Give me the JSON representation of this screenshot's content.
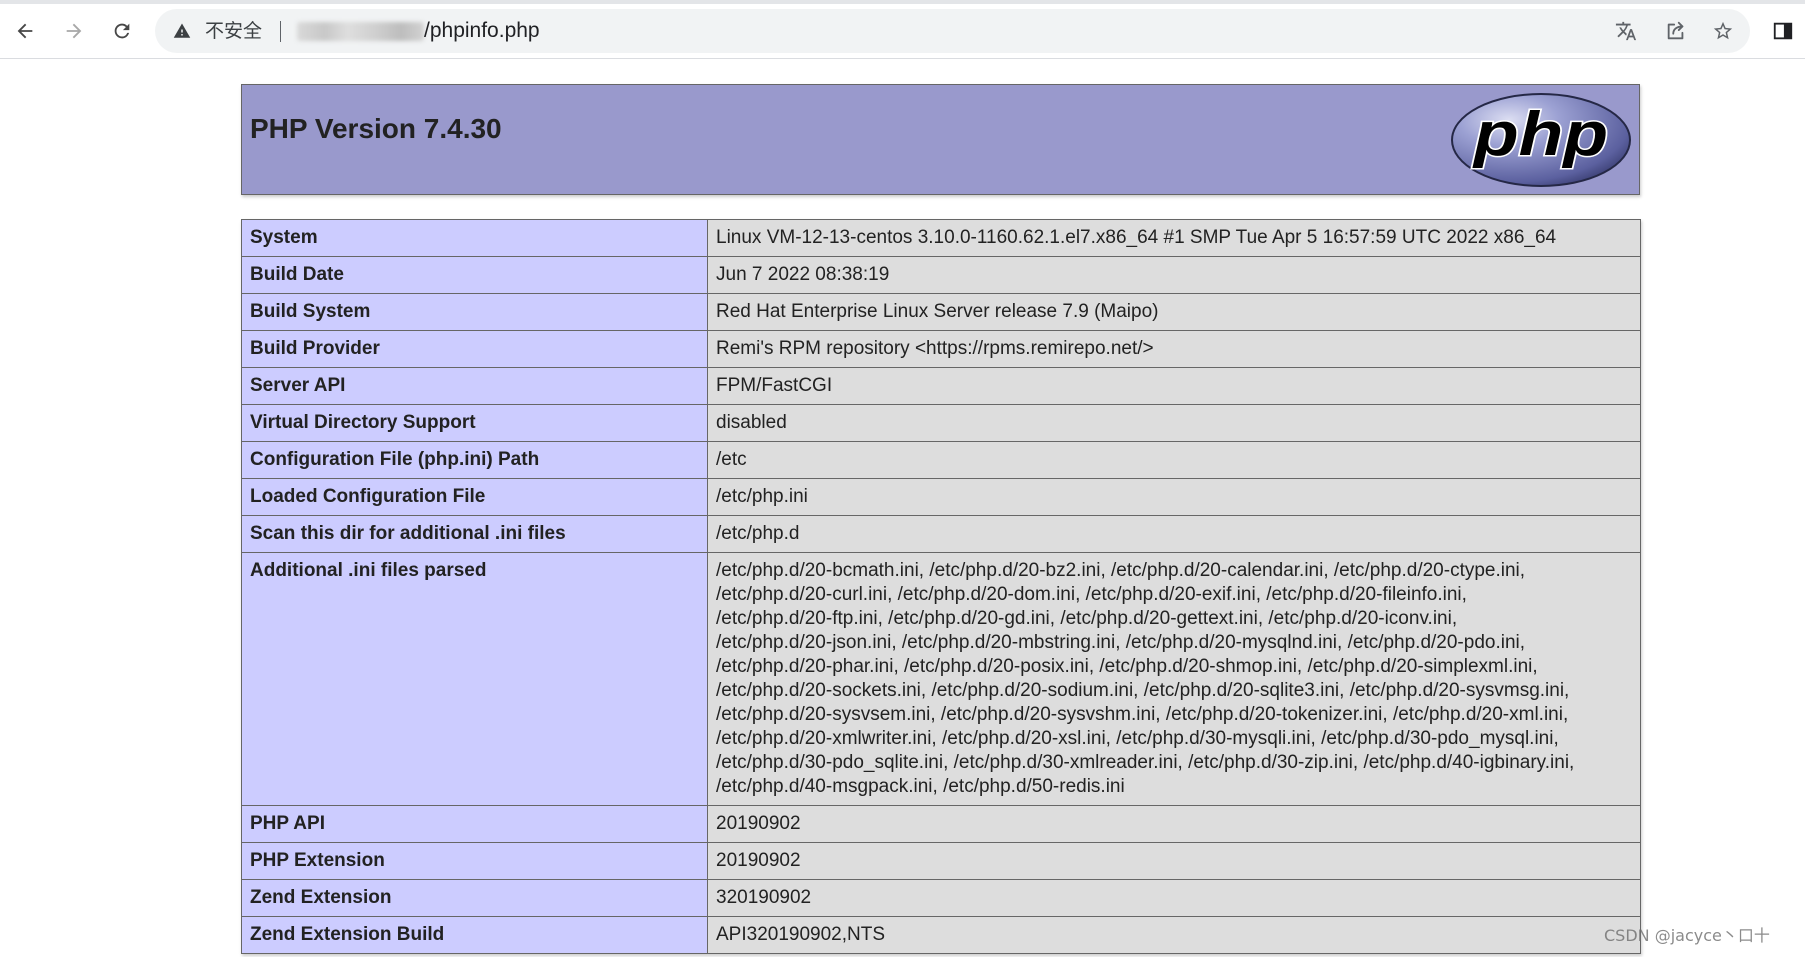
{
  "browser": {
    "security_label": "不安全",
    "url_path": "/phpinfo.php",
    "icons": {
      "back": "back-arrow-icon",
      "forward": "forward-arrow-icon",
      "reload": "reload-icon",
      "security": "warning-triangle-icon",
      "translate": "translate-icon",
      "share": "share-icon",
      "bookmark": "star-icon",
      "side_panel": "side-panel-icon"
    }
  },
  "header": {
    "title": "PHP Version 7.4.30",
    "logo_text": "php"
  },
  "rows": [
    {
      "label": "System",
      "value": "Linux VM-12-13-centos 3.10.0-1160.62.1.el7.x86_64 #1 SMP Tue Apr 5 16:57:59 UTC 2022 x86_64"
    },
    {
      "label": "Build Date",
      "value": "Jun 7 2022 08:38:19"
    },
    {
      "label": "Build System",
      "value": "Red Hat Enterprise Linux Server release 7.9 (Maipo)"
    },
    {
      "label": "Build Provider",
      "value": "Remi's RPM repository <https://rpms.remirepo.net/>"
    },
    {
      "label": "Server API",
      "value": "FPM/FastCGI"
    },
    {
      "label": "Virtual Directory Support",
      "value": "disabled"
    },
    {
      "label": "Configuration File (php.ini) Path",
      "value": "/etc"
    },
    {
      "label": "Loaded Configuration File",
      "value": "/etc/php.ini"
    },
    {
      "label": "Scan this dir for additional .ini files",
      "value": "/etc/php.d"
    },
    {
      "label": "Additional .ini files parsed",
      "lines": [
        "/etc/php.d/20-bcmath.ini, /etc/php.d/20-bz2.ini, /etc/php.d/20-calendar.ini, /etc/php.d/20-ctype.ini,",
        "/etc/php.d/20-curl.ini, /etc/php.d/20-dom.ini, /etc/php.d/20-exif.ini, /etc/php.d/20-fileinfo.ini,",
        "/etc/php.d/20-ftp.ini, /etc/php.d/20-gd.ini, /etc/php.d/20-gettext.ini, /etc/php.d/20-iconv.ini,",
        "/etc/php.d/20-json.ini, /etc/php.d/20-mbstring.ini, /etc/php.d/20-mysqlnd.ini, /etc/php.d/20-pdo.ini,",
        "/etc/php.d/20-phar.ini, /etc/php.d/20-posix.ini, /etc/php.d/20-shmop.ini, /etc/php.d/20-simplexml.ini,",
        "/etc/php.d/20-sockets.ini, /etc/php.d/20-sodium.ini, /etc/php.d/20-sqlite3.ini, /etc/php.d/20-sysvmsg.ini,",
        "/etc/php.d/20-sysvsem.ini, /etc/php.d/20-sysvshm.ini, /etc/php.d/20-tokenizer.ini, /etc/php.d/20-xml.ini,",
        "/etc/php.d/20-xmlwriter.ini, /etc/php.d/20-xsl.ini, /etc/php.d/30-mysqli.ini, /etc/php.d/30-pdo_mysql.ini,",
        "/etc/php.d/30-pdo_sqlite.ini, /etc/php.d/30-xmlreader.ini, /etc/php.d/30-zip.ini, /etc/php.d/40-igbinary.ini,",
        "/etc/php.d/40-msgpack.ini, /etc/php.d/50-redis.ini"
      ]
    },
    {
      "label": "PHP API",
      "value": "20190902"
    },
    {
      "label": "PHP Extension",
      "value": "20190902"
    },
    {
      "label": "Zend Extension",
      "value": "320190902"
    },
    {
      "label": "Zend Extension Build",
      "value": "API320190902,NTS"
    }
  ],
  "watermark": "CSDN @jacyce丶口十",
  "colors": {
    "header_bg": "#9999cc",
    "label_bg": "#ccccff",
    "value_bg": "#dddddd",
    "border": "#666666"
  }
}
